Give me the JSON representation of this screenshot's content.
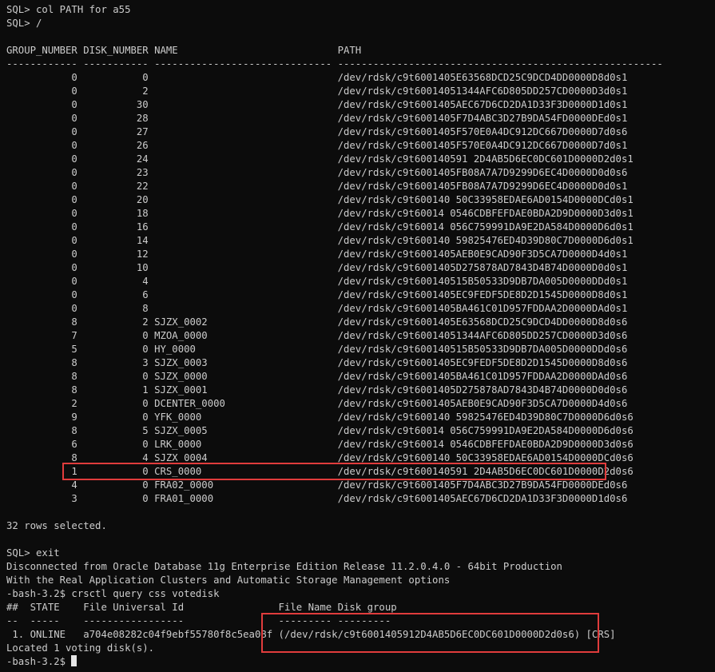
{
  "terminal": {
    "lines": [
      "SQL> col PATH for a55",
      "SQL> /",
      "",
      "GROUP_NUMBER DISK_NUMBER NAME                           PATH",
      "------------ ----------- ------------------------------ -------------------------------------------------------",
      "           0           0                                /dev/rdsk/c9t6001405E63568DCD25C9DCD4DD0000D8d0s1",
      "           0           2                                /dev/rdsk/c9t60014051344AFC6D805DD257CD0000D3d0s1",
      "           0          30                                /dev/rdsk/c9t6001405AEC67D6CD2DA1D33F3D0000D1d0s1",
      "           0          28                                /dev/rdsk/c9t6001405F7D4ABC3D27B9DA54FD0000DEd0s1",
      "           0          27                                /dev/rdsk/c9t6001405F570E0A4DC912DC667D0000D7d0s6",
      "           0          26                                /dev/rdsk/c9t6001405F570E0A4DC912DC667D0000D7d0s1",
      "           0          24                                /dev/rdsk/c9t600140591 2D4AB5D6EC0DC601D0000D2d0s1",
      "           0          23                                /dev/rdsk/c9t6001405FB08A7A7D9299D6EC4D0000D0d0s6",
      "           0          22                                /dev/rdsk/c9t6001405FB08A7A7D9299D6EC4D0000D0d0s1",
      "           0          20                                /dev/rdsk/c9t600140 50C33958EDAE6AD0154D0000DCd0s1",
      "           0          18                                /dev/rdsk/c9t60014 0546CDBFEFDAE0BDA2D9D0000D3d0s1",
      "           0          16                                /dev/rdsk/c9t60014 056C759991DA9E2DA584D0000D6d0s1",
      "           0          14                                /dev/rdsk/c9t600140 59825476ED4D39D80C7D0000D6d0s1",
      "           0          12                                /dev/rdsk/c9t6001405AEB0E9CAD90F3D5CA7D0000D4d0s1",
      "           0          10                                /dev/rdsk/c9t6001405D275878AD7843D4B74D0000D0d0s1",
      "           0           4                                /dev/rdsk/c9t600140515B50533D9DB7DA005D0000DDd0s1",
      "           0           6                                /dev/rdsk/c9t6001405EC9FEDF5DE8D2D1545D0000D8d0s1",
      "           0           8                                /dev/rdsk/c9t6001405BA461C01D957FDDAA2D0000DAd0s1",
      "           8           2 SJZX_0002                      /dev/rdsk/c9t6001405E63568DCD25C9DCD4DD0000D8d0s6",
      "           7           0 MZOA_0000                      /dev/rdsk/c9t60014051344AFC6D805DD257CD0000D3d0s6",
      "           5           0 HY_0000                        /dev/rdsk/c9t600140515B50533D9DB7DA005D0000DDd0s6",
      "           8           3 SJZX_0003                      /dev/rdsk/c9t6001405EC9FEDF5DE8D2D1545D0000D8d0s6",
      "           8           0 SJZX_0000                      /dev/rdsk/c9t6001405BA461C01D957FDDAA2D0000DAd0s6",
      "           8           1 SJZX_0001                      /dev/rdsk/c9t6001405D275878AD7843D4B74D0000D0d0s6",
      "           2           0 DCENTER_0000                   /dev/rdsk/c9t6001405AEB0E9CAD90F3D5CA7D0000D4d0s6",
      "           9           0 YFK_0000                       /dev/rdsk/c9t600140 59825476ED4D39D80C7D0000D6d0s6",
      "           8           5 SJZX_0005                      /dev/rdsk/c9t60014 056C759991DA9E2DA584D0000D6d0s6",
      "           6           0 LRK_0000                       /dev/rdsk/c9t60014 0546CDBFEFDAE0BDA2D9D0000D3d0s6",
      "           8           4 SJZX_0004                      /dev/rdsk/c9t600140 50C33958EDAE6AD0154D0000DCd0s6",
      "           1           0 CRS_0000                       /dev/rdsk/c9t600140591 2D4AB5D6EC0DC601D0000D2d0s6",
      "           4           0 FRA02_0000                     /dev/rdsk/c9t6001405F7D4ABC3D27B9DA54FD0000DEd0s6",
      "           3           0 FRA01_0000                     /dev/rdsk/c9t6001405AEC67D6CD2DA1D33F3D0000D1d0s6",
      "",
      "32 rows selected.",
      "",
      "SQL> exit",
      "Disconnected from Oracle Database 11g Enterprise Edition Release 11.2.0.4.0 - 64bit Production",
      "With the Real Application Clusters and Automatic Storage Management options",
      "-bash-3.2$ crsctl query css votedisk",
      "##  STATE    File Universal Id                File Name Disk group",
      "--  -----    -----------------                --------- ---------",
      " 1. ONLINE   a704e08282c04f9ebf55780f8c5ea08f (/dev/rdsk/c9t6001405912D4AB5D6EC0DC601D0000D2d0s6) [CRS]",
      "Located 1 voting disk(s).",
      "-bash-3.2$ "
    ]
  }
}
